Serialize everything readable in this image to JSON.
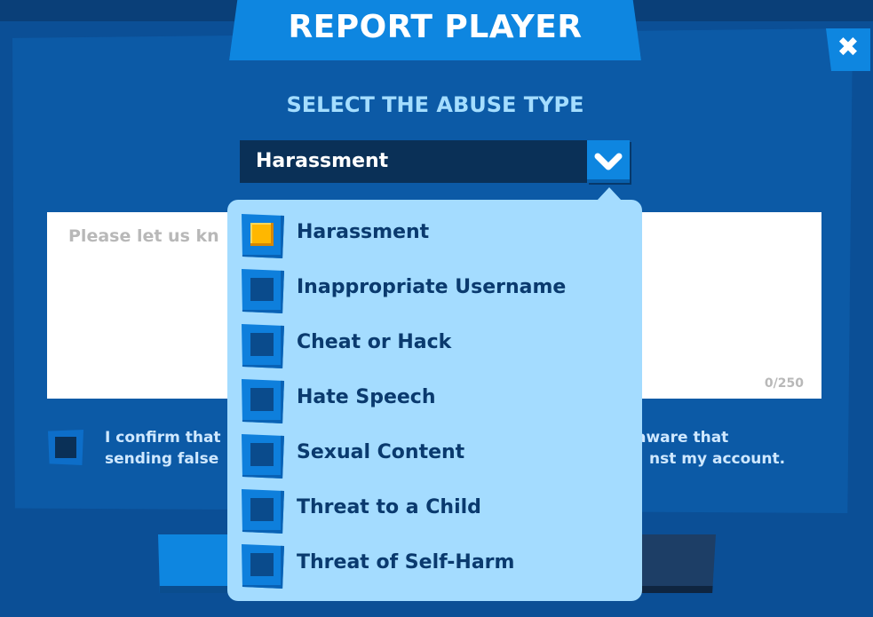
{
  "dialog": {
    "title": "REPORT PLAYER",
    "close_icon": "close-icon",
    "subtitle": "SELECT THE ABUSE TYPE",
    "selected_type": "Harassment",
    "textarea_placeholder": "Please let us kn",
    "char_counter": "0/250",
    "confirm_text_line1": "I confirm that",
    "confirm_text_line1_end": "aware that",
    "confirm_text_line2": "sending false",
    "confirm_text_line2_end": "nst my account."
  },
  "dropdown": {
    "options": [
      {
        "label": "Harassment",
        "checked": true
      },
      {
        "label": "Inappropriate Username",
        "checked": false
      },
      {
        "label": "Cheat or Hack",
        "checked": false
      },
      {
        "label": "Hate Speech",
        "checked": false
      },
      {
        "label": "Sexual Content",
        "checked": false
      },
      {
        "label": "Threat to a Child",
        "checked": false
      },
      {
        "label": "Threat of Self-Harm",
        "checked": false
      }
    ]
  },
  "colors": {
    "background": "#0b4f96",
    "accent": "#0e86e0",
    "dropdown_bg": "#a4dcff",
    "checked": "#ffb700"
  }
}
